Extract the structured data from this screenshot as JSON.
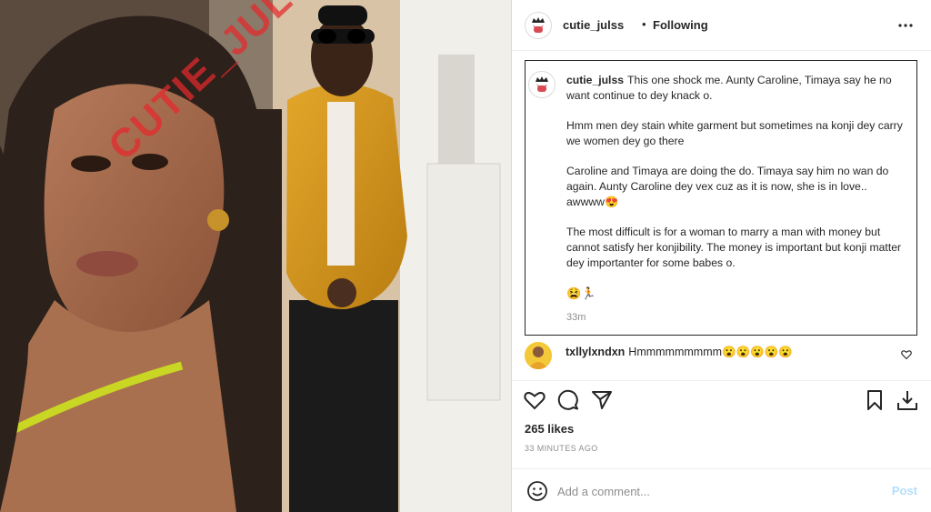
{
  "photo": {
    "watermark": "CUTIE_JULSS"
  },
  "header": {
    "username": "cutie_julss",
    "separator": "•",
    "follow_status": "Following",
    "more_icon": "more-horizontal-icon"
  },
  "caption": {
    "username": "cutie_julss",
    "first_line": "This one shock me. Aunty Caroline, Timaya say he no want continue to dey knack o.",
    "paragraphs": [
      "Hmm men dey stain white garment but sometimes na konji dey carry we women dey go there",
      "Caroline and Timaya are doing the do. Timaya say him no wan do again. Aunty Caroline dey vex cuz as it is now, she is in love.. awwww😍",
      "The most difficult is for a woman to marry a man with money but cannot satisfy her konjibility. The money is important but konji matter dey importanter for some babes o."
    ],
    "emojis": "😫🏃",
    "time": "33m"
  },
  "comment": {
    "username": "txllylxndxn",
    "text": "Hmmmmmmmmm😮😮😮😮😮",
    "like_icon": "heart-outline-icon"
  },
  "actions": {
    "icons": [
      "heart-icon",
      "comment-icon",
      "share-icon",
      "bookmark-icon",
      "download-icon"
    ]
  },
  "likes": "265 likes",
  "posted": "33 MINUTES AGO",
  "add_comment": {
    "placeholder": "Add a comment...",
    "post_label": "Post",
    "post_color": "#b2dffc"
  }
}
